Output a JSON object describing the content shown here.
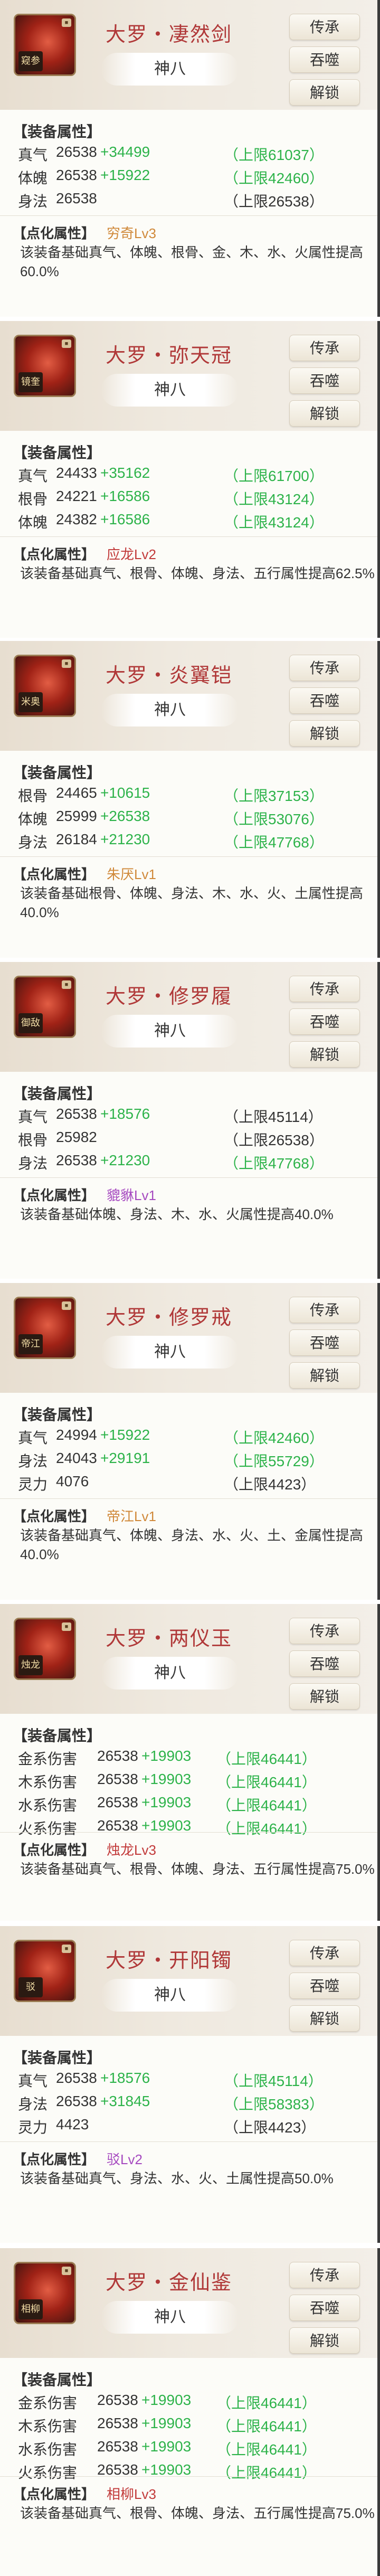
{
  "ui": {
    "pass_on_label": "传承",
    "devour_label": "吞噬",
    "unlock_label": "解锁",
    "attrs_header": "【装备属性】",
    "dianhua_header": "【点化属性】"
  },
  "colors": {
    "title": "#b03838",
    "bonus": "#2db34a"
  },
  "cards": [
    {
      "title": "大罗・凄然剑",
      "grade": "神八",
      "badge": "窥参",
      "attrs": [
        {
          "name": "真气",
          "value": "26538",
          "bonus": "+34499",
          "limit": "（上限61037）",
          "limit_green": true
        },
        {
          "name": "体魄",
          "value": "26538",
          "bonus": "+15922",
          "limit": "（上限42460）",
          "limit_green": true
        },
        {
          "name": "身法",
          "value": "26538",
          "bonus": "",
          "limit": "（上限26538）",
          "limit_green": false
        }
      ],
      "dianhua": {
        "level": "穷奇Lv3",
        "level_color": "#d0893a",
        "text": "该装备基础真气、体魄、根骨、金、木、水、火属性提高60.0%"
      }
    },
    {
      "title": "大罗・弥天冠",
      "grade": "神八",
      "badge": "镜奎",
      "attrs": [
        {
          "name": "真气",
          "value": "24433",
          "bonus": "+35162",
          "limit": "（上限61700）",
          "limit_green": true
        },
        {
          "name": "根骨",
          "value": "24221",
          "bonus": "+16586",
          "limit": "（上限43124）",
          "limit_green": true
        },
        {
          "name": "体魄",
          "value": "24382",
          "bonus": "+16586",
          "limit": "（上限43124）",
          "limit_green": true
        }
      ],
      "dianhua": {
        "level": "应龙Lv2",
        "level_color": "#c23a3a",
        "text": "该装备基础真气、根骨、体魄、身法、五行属性提高62.5%"
      }
    },
    {
      "title": "大罗・炎翼铠",
      "grade": "神八",
      "badge": "米奥",
      "attrs": [
        {
          "name": "根骨",
          "value": "24465",
          "bonus": "+10615",
          "limit": "（上限37153）",
          "limit_green": true
        },
        {
          "name": "体魄",
          "value": "25999",
          "bonus": "+26538",
          "limit": "（上限53076）",
          "limit_green": true
        },
        {
          "name": "身法",
          "value": "26184",
          "bonus": "+21230",
          "limit": "（上限47768）",
          "limit_green": true
        }
      ],
      "dianhua": {
        "level": "朱厌Lv1",
        "level_color": "#d0893a",
        "text": "该装备基础根骨、体魄、身法、木、水、火、土属性提高40.0%"
      }
    },
    {
      "title": "大罗・修罗履",
      "grade": "神八",
      "badge": "御敌",
      "attrs": [
        {
          "name": "真气",
          "value": "26538",
          "bonus": "+18576",
          "limit": "（上限45114）",
          "limit_green": false
        },
        {
          "name": "根骨",
          "value": "25982",
          "bonus": "",
          "limit": "（上限26538）",
          "limit_green": false
        },
        {
          "name": "身法",
          "value": "26538",
          "bonus": "+21230",
          "limit": "（上限47768）",
          "limit_green": true
        }
      ],
      "dianhua": {
        "level": "貔貅Lv1",
        "level_color": "#a64ac0",
        "text": "该装备基础体魄、身法、木、水、火属性提高40.0%"
      }
    },
    {
      "title": "大罗・修罗戒",
      "grade": "神八",
      "badge": "帝江",
      "attrs": [
        {
          "name": "真气",
          "value": "24994",
          "bonus": "+15922",
          "limit": "（上限42460）",
          "limit_green": true
        },
        {
          "name": "身法",
          "value": "24043",
          "bonus": "+29191",
          "limit": "（上限55729）",
          "limit_green": true
        },
        {
          "name": "灵力",
          "value": "4076",
          "bonus": "",
          "limit": "（上限4423）",
          "limit_green": false
        }
      ],
      "dianhua": {
        "level": "帝江Lv1",
        "level_color": "#d0893a",
        "text": "该装备基础真气、体魄、身法、水、火、土、金属性提高40.0%"
      }
    },
    {
      "title": "大罗・两仪玉",
      "grade": "神八",
      "badge": "烛龙",
      "attrs": [
        {
          "name": "金系伤害",
          "value": "26538",
          "bonus": "+19903",
          "limit": "（上限46441）",
          "limit_green": true
        },
        {
          "name": "木系伤害",
          "value": "26538",
          "bonus": "+19903",
          "limit": "（上限46441）",
          "limit_green": true
        },
        {
          "name": "水系伤害",
          "value": "26538",
          "bonus": "+19903",
          "limit": "（上限46441）",
          "limit_green": true
        },
        {
          "name": "火系伤害",
          "value": "26538",
          "bonus": "+19903",
          "limit": "（上限46441）",
          "limit_green": true
        }
      ],
      "dianhua": {
        "level": "烛龙Lv3",
        "level_color": "#c23a3a",
        "text": "该装备基础真气、根骨、体魄、身法、五行属性提高75.0%"
      }
    },
    {
      "title": "大罗・开阳镯",
      "grade": "神八",
      "badge": "驳",
      "attrs": [
        {
          "name": "真气",
          "value": "26538",
          "bonus": "+18576",
          "limit": "（上限45114）",
          "limit_green": true
        },
        {
          "name": "身法",
          "value": "26538",
          "bonus": "+31845",
          "limit": "（上限58383）",
          "limit_green": true
        },
        {
          "name": "灵力",
          "value": "4423",
          "bonus": "",
          "limit": "（上限4423）",
          "limit_green": false
        }
      ],
      "dianhua": {
        "level": "驳Lv2",
        "level_color": "#a64ac0",
        "text": "该装备基础真气、身法、水、火、土属性提高50.0%"
      }
    },
    {
      "title": "大罗・金仙鉴",
      "grade": "神八",
      "badge": "相柳",
      "attrs": [
        {
          "name": "金系伤害",
          "value": "26538",
          "bonus": "+19903",
          "limit": "（上限46441）",
          "limit_green": true
        },
        {
          "name": "木系伤害",
          "value": "26538",
          "bonus": "+19903",
          "limit": "（上限46441）",
          "limit_green": true
        },
        {
          "name": "水系伤害",
          "value": "26538",
          "bonus": "+19903",
          "limit": "（上限46441）",
          "limit_green": true
        },
        {
          "name": "火系伤害",
          "value": "26538",
          "bonus": "+19903",
          "limit": "（上限46441）",
          "limit_green": true
        }
      ],
      "dianhua": {
        "level": "相柳Lv3",
        "level_color": "#c23a3a",
        "text": "该装备基础真气、根骨、体魄、身法、五行属性提高75.0%"
      }
    }
  ]
}
